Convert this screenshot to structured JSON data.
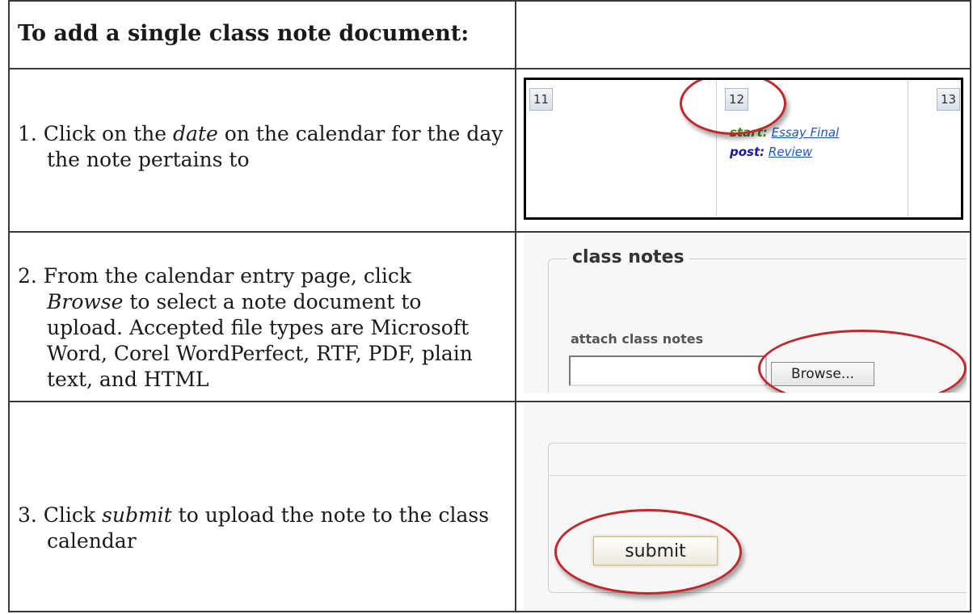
{
  "header": {
    "title": "To add a single class note document:"
  },
  "steps": [
    {
      "number": "1.",
      "pre": " Click on the ",
      "em": "date",
      "post": " on the calendar for the day the note pertains to"
    },
    {
      "number": "2.",
      "pre": " From the calendar entry page, click ",
      "em": "Browse",
      "post": " to select a note document to upload. Accepted file types are Microsoft Word, Corel WordPerfect, RTF, PDF, plain text, and HTML"
    },
    {
      "number": "3.",
      "pre": " Click ",
      "em": "submit",
      "post": " to upload the note to the class calendar"
    }
  ],
  "calendar": {
    "days": [
      "11",
      "12",
      "13"
    ],
    "entries": [
      {
        "label": "start:",
        "link": "Essay Final"
      },
      {
        "label": "post:",
        "link": "Review"
      }
    ]
  },
  "class_notes": {
    "legend": "class notes",
    "attach_label": "attach class notes",
    "file_value": "",
    "browse_label": "Browse..."
  },
  "submit_panel": {
    "submit_label": "submit"
  },
  "colors": {
    "highlight_ring": "#c1272d",
    "border": "#3a3a3a"
  }
}
